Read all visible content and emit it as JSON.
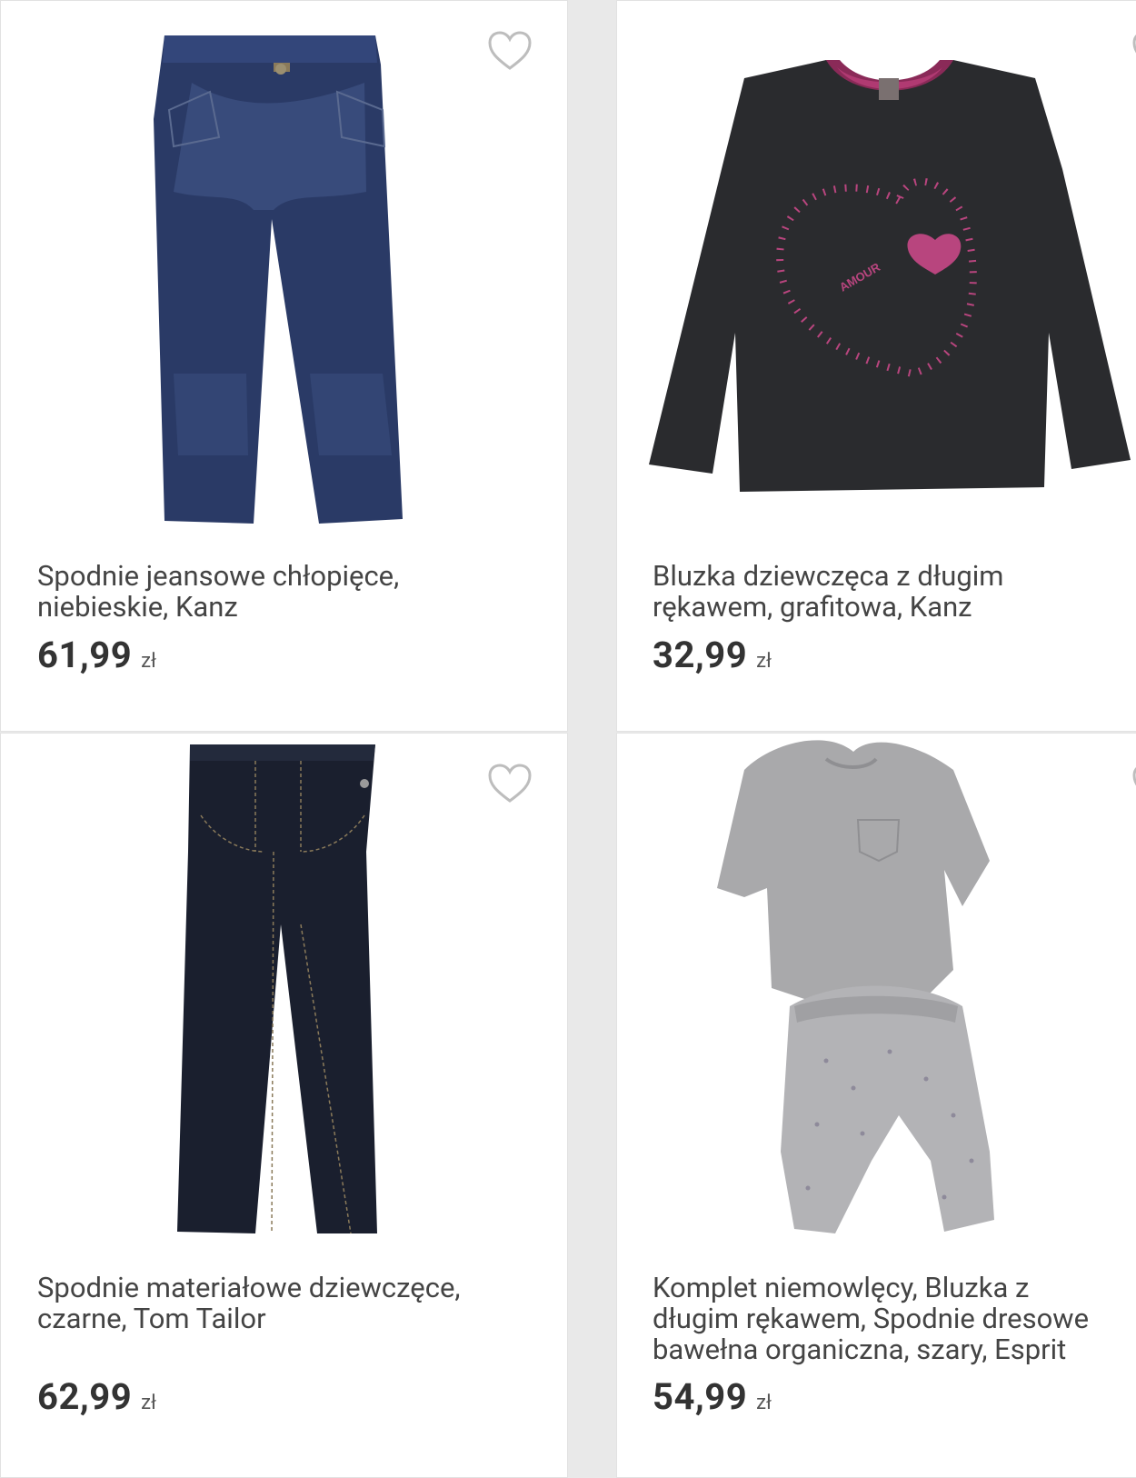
{
  "currency": "zł",
  "products": [
    {
      "title": "Spodnie jeansowe chłopięce,\nniebieskie, Kanz",
      "price": "61,99",
      "image": "jeans-image"
    },
    {
      "title": "Bluzka dziewczęca z długim\nrękawem, grafitowa, Kanz",
      "price": "32,99",
      "image": "blouse-image"
    },
    {
      "title": "Spodnie materiałowe dziewczęce,\nczarne, Tom Tailor",
      "price": "62,99",
      "image": "trousers-image"
    },
    {
      "title": "Komplet niemowlęcy, Bluzka z\ndługim rękawem, Spodnie dresowe\nbawełna organiczna, szary, Esprit",
      "price": "54,99",
      "image": "baby-set-image"
    }
  ],
  "print_text": "AMOUR",
  "colors": {
    "heart_outline": "#bdbdbd",
    "text": "#444444",
    "price": "#333333",
    "background": "#e9e9e9",
    "card": "#ffffff"
  }
}
